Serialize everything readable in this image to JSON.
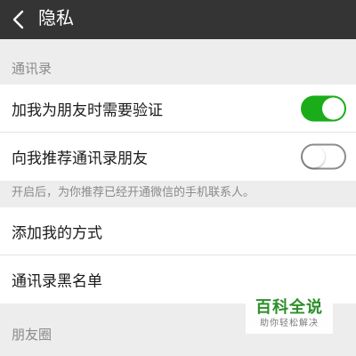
{
  "navbar": {
    "title": "隐私",
    "back_icon": "chevron-left-icon"
  },
  "contacts_section": {
    "header": "通讯录",
    "items": [
      {
        "label": "加我为朋友时需要验证",
        "toggle": true
      },
      {
        "label": "向我推荐通讯录朋友",
        "toggle": false
      }
    ],
    "hint": "开启后，为你推荐已经开通微信的手机联系人。"
  },
  "other_items": [
    {
      "label": "添加我的方式"
    },
    {
      "label": "通讯录黑名单"
    }
  ],
  "moments_section": {
    "header": "朋友圈"
  },
  "watermark": {
    "main": "百科全说",
    "sub": "助你轻松解决"
  },
  "colors": {
    "navbar_bg": "#343434",
    "toggle_on": "#1aad19",
    "page_bg": "#ededed"
  }
}
